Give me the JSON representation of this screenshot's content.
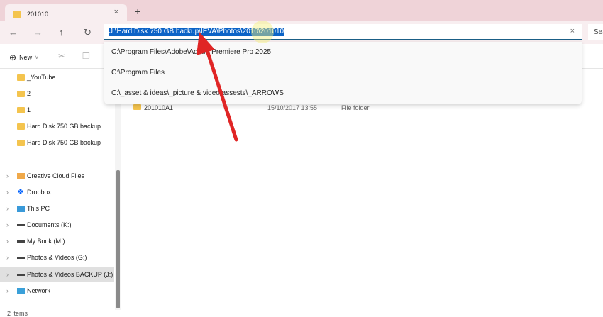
{
  "tab": {
    "title": "201010",
    "close": "×",
    "new": "+"
  },
  "nav": {
    "back": "←",
    "forward": "→",
    "up": "↑",
    "refresh": "↻"
  },
  "address": {
    "value": "J:\\Hard Disk 750 GB backup\\IEVA\\Photos\\2010\\201010",
    "clear": "×"
  },
  "search": {
    "placeholder": "Sea"
  },
  "toolbar": {
    "new_label": "New",
    "new_caret": "˅"
  },
  "suggestions": [
    "C:\\Program Files\\Adobe\\Adobe Premiere Pro 2025",
    "C:\\Program Files",
    "C:\\_asset & ideas\\_picture & video assests\\_ARROWS"
  ],
  "sidebar": {
    "quick": [
      "_YouTube",
      "2",
      "1",
      "Hard Disk 750 GB backup",
      "Hard Disk 750 GB backup"
    ],
    "tree": [
      "Creative Cloud Files",
      "Dropbox",
      "This PC",
      "Documents (K:)",
      "My Book (M:)",
      "Photos & Videos (G:)",
      "Photos & Videos BACKUP (J:)",
      "Network"
    ]
  },
  "files": [
    {
      "name": "201010A1",
      "date": "15/10/2017 13:55",
      "type": "File folder"
    }
  ],
  "status": "2 items",
  "colors": {
    "accent": "#0c63c7",
    "arrow": "#e02525"
  }
}
